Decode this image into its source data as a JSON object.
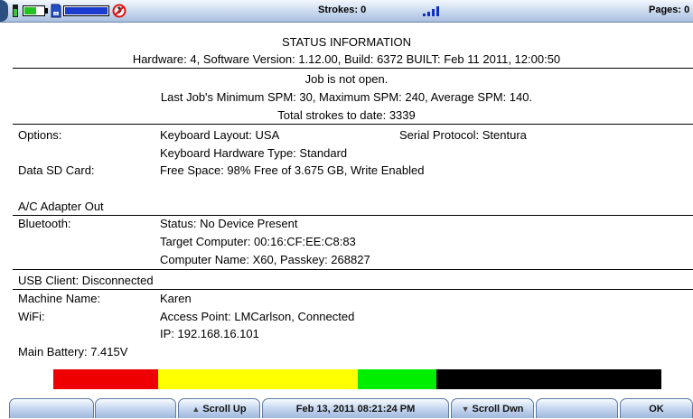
{
  "status_bar": {
    "strokes": "Strokes: 0",
    "pages": "Pages: 0",
    "icons": [
      "usb-power-icon",
      "battery-icon",
      "sd-card-icon",
      "sd-capacity-icon",
      "no-bluetooth-icon",
      "signal-strength-icon"
    ]
  },
  "header": {
    "title": "STATUS INFORMATION",
    "hardware": "Hardware: 4, Software Version: 1.12.00, Build: 6372   BUILT: Feb 11 2011, 12:00:50"
  },
  "job": {
    "status": "Job is not open.",
    "spm": "Last Job's Minimum SPM: 30,  Maximum SPM: 240, Average SPM: 140.",
    "total": "Total strokes to date: 3339"
  },
  "options": {
    "label": "Options:",
    "keyboard_layout": "Keyboard Layout: USA",
    "serial_protocol": "Serial Protocol: Stentura",
    "hardware_type": "Keyboard Hardware Type: Standard"
  },
  "sd_card": {
    "label": "Data SD Card:",
    "value": "Free Space: 98% Free of 3.675 GB, Write Enabled"
  },
  "adapter": "A/C Adapter Out",
  "bluetooth": {
    "label": "Bluetooth:",
    "status": "Status: No Device Present",
    "target": "Target Computer: 00:16:CF:EE:C8:83",
    "computer": "Computer Name: X60,  Passkey: 268827"
  },
  "usb": "USB Client: Disconnected",
  "machine": {
    "label": "Machine Name:",
    "value": "Karen"
  },
  "wifi": {
    "label": "WiFi:",
    "access_point": "Access Point: LMCarlson, Connected",
    "ip": "IP: 192.168.16.101"
  },
  "battery": {
    "label": "Main Battery: 7.415V",
    "level_fraction": 0.63,
    "colors": {
      "red": "#ee0000",
      "yellow": "#ffff00",
      "green": "#00ee00",
      "empty": "#000000"
    }
  },
  "buttons": {
    "scroll_up": "Scroll Up",
    "datetime": "Feb 13, 2011  08:21:24 PM",
    "scroll_down": "Scroll Dwn",
    "ok": "OK"
  }
}
